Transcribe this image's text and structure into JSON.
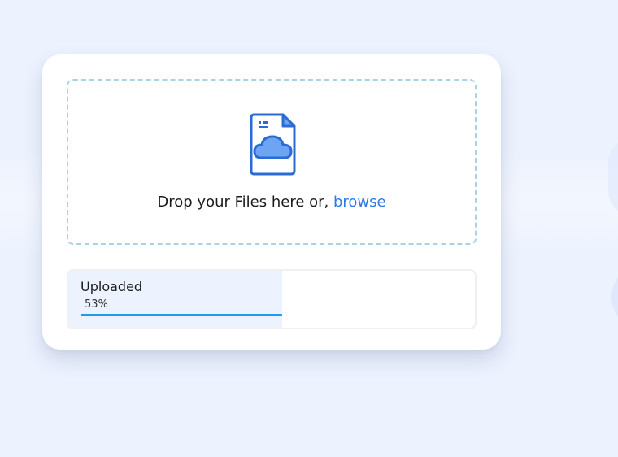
{
  "dropzone": {
    "prompt": "Drop your Files here or, ",
    "browse_label": "browse",
    "icon": "file-cloud-icon"
  },
  "upload": {
    "label": "Uploaded",
    "percent_text": "53%",
    "progress": 0.53
  },
  "colors": {
    "background": "#ecf2fe",
    "accent": "#2f79e8",
    "progress_bar": "#1d9bf0",
    "dropzone_border": "#a8d3e6"
  }
}
